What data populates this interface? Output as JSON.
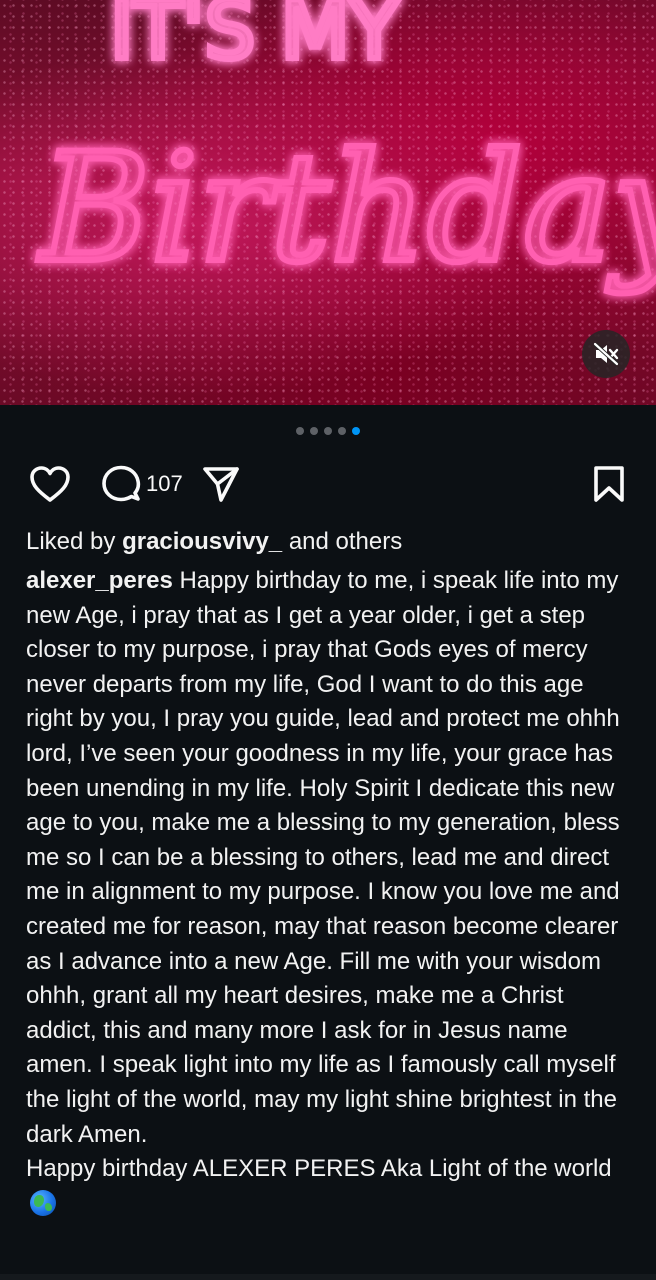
{
  "media": {
    "neon_line1": "IT'S MY",
    "neon_line2": "Birthday",
    "neon_color": "#ff3fa0",
    "mute_icon": "muted-speaker-icon"
  },
  "carousel": {
    "total": 5,
    "active_index": 4,
    "active_color": "#0095f6"
  },
  "actions": {
    "like_icon": "heart-icon",
    "comment_icon": "comment-bubble-icon",
    "comment_count": "107",
    "share_icon": "paper-plane-icon",
    "save_icon": "bookmark-icon"
  },
  "likes": {
    "prefix": "Liked by ",
    "user": "graciousvivy_",
    "suffix": " and others"
  },
  "caption": {
    "username": "alexer_peres",
    "text": " Happy birthday to me, i speak life into my new Age, i pray that as I get a year older, i get a step closer to my purpose, i pray that Gods eyes of mercy never departs from my life, God I want to do this age right by you, I pray you guide, lead and protect me ohhh lord, I’ve seen your goodness in my life, your grace has been unending in my life. Holy Spirit I dedicate this new age to you, make me a blessing to my generation, bless me so I can be a blessing to others, lead me and direct me in alignment to my purpose. I know you love me and created me for reason, may that reason become clearer as I advance into a new Age. Fill me with your wisdom ohhh, grant all my heart desires, make me a Christ addict, this and many more I ask for in Jesus name amen. I speak light into my life as I famously call myself the light of the world, may my light shine brightest in the dark Amen.\nHappy birthday ALEXER PERES Aka Light of the world ",
    "emoji_icon": "globe-emoji-icon"
  }
}
